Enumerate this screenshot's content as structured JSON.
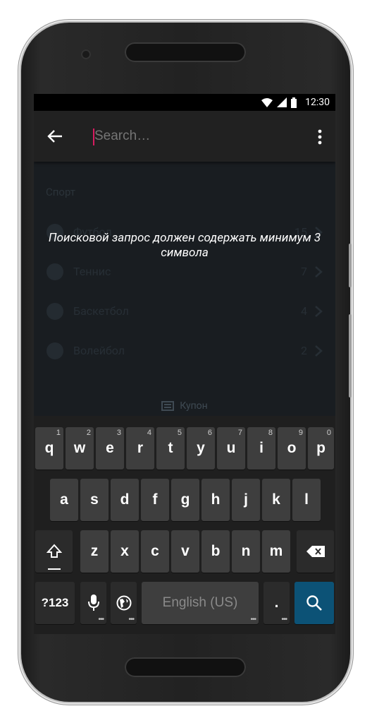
{
  "status_bar": {
    "time": "12:30"
  },
  "app_bar": {
    "search_placeholder": "Search…"
  },
  "section_title": "Спорт",
  "sports": [
    {
      "name": "Футбол",
      "count": "15"
    },
    {
      "name": "Теннис",
      "count": "7"
    },
    {
      "name": "Баскетбол",
      "count": "4"
    },
    {
      "name": "Волейбол",
      "count": "2"
    }
  ],
  "toast_message": "Поисковой запрос должен содержать минимум 3 символа",
  "coupon_label": "Купон",
  "keyboard": {
    "row1": [
      {
        "label": "q",
        "hint": "1"
      },
      {
        "label": "w",
        "hint": "2"
      },
      {
        "label": "e",
        "hint": "3"
      },
      {
        "label": "r",
        "hint": "4"
      },
      {
        "label": "t",
        "hint": "5"
      },
      {
        "label": "y",
        "hint": "6"
      },
      {
        "label": "u",
        "hint": "7"
      },
      {
        "label": "i",
        "hint": "8"
      },
      {
        "label": "o",
        "hint": "9"
      },
      {
        "label": "p",
        "hint": "0"
      }
    ],
    "row2": [
      "a",
      "s",
      "d",
      "f",
      "g",
      "h",
      "j",
      "k",
      "l"
    ],
    "row3": [
      "z",
      "x",
      "c",
      "v",
      "b",
      "n",
      "m"
    ],
    "symbols_label": "?123",
    "space_label": "English (US)",
    "period_label": "."
  },
  "colors": {
    "accent_cursor": "#d81b60",
    "search_key": "#0c5276"
  }
}
